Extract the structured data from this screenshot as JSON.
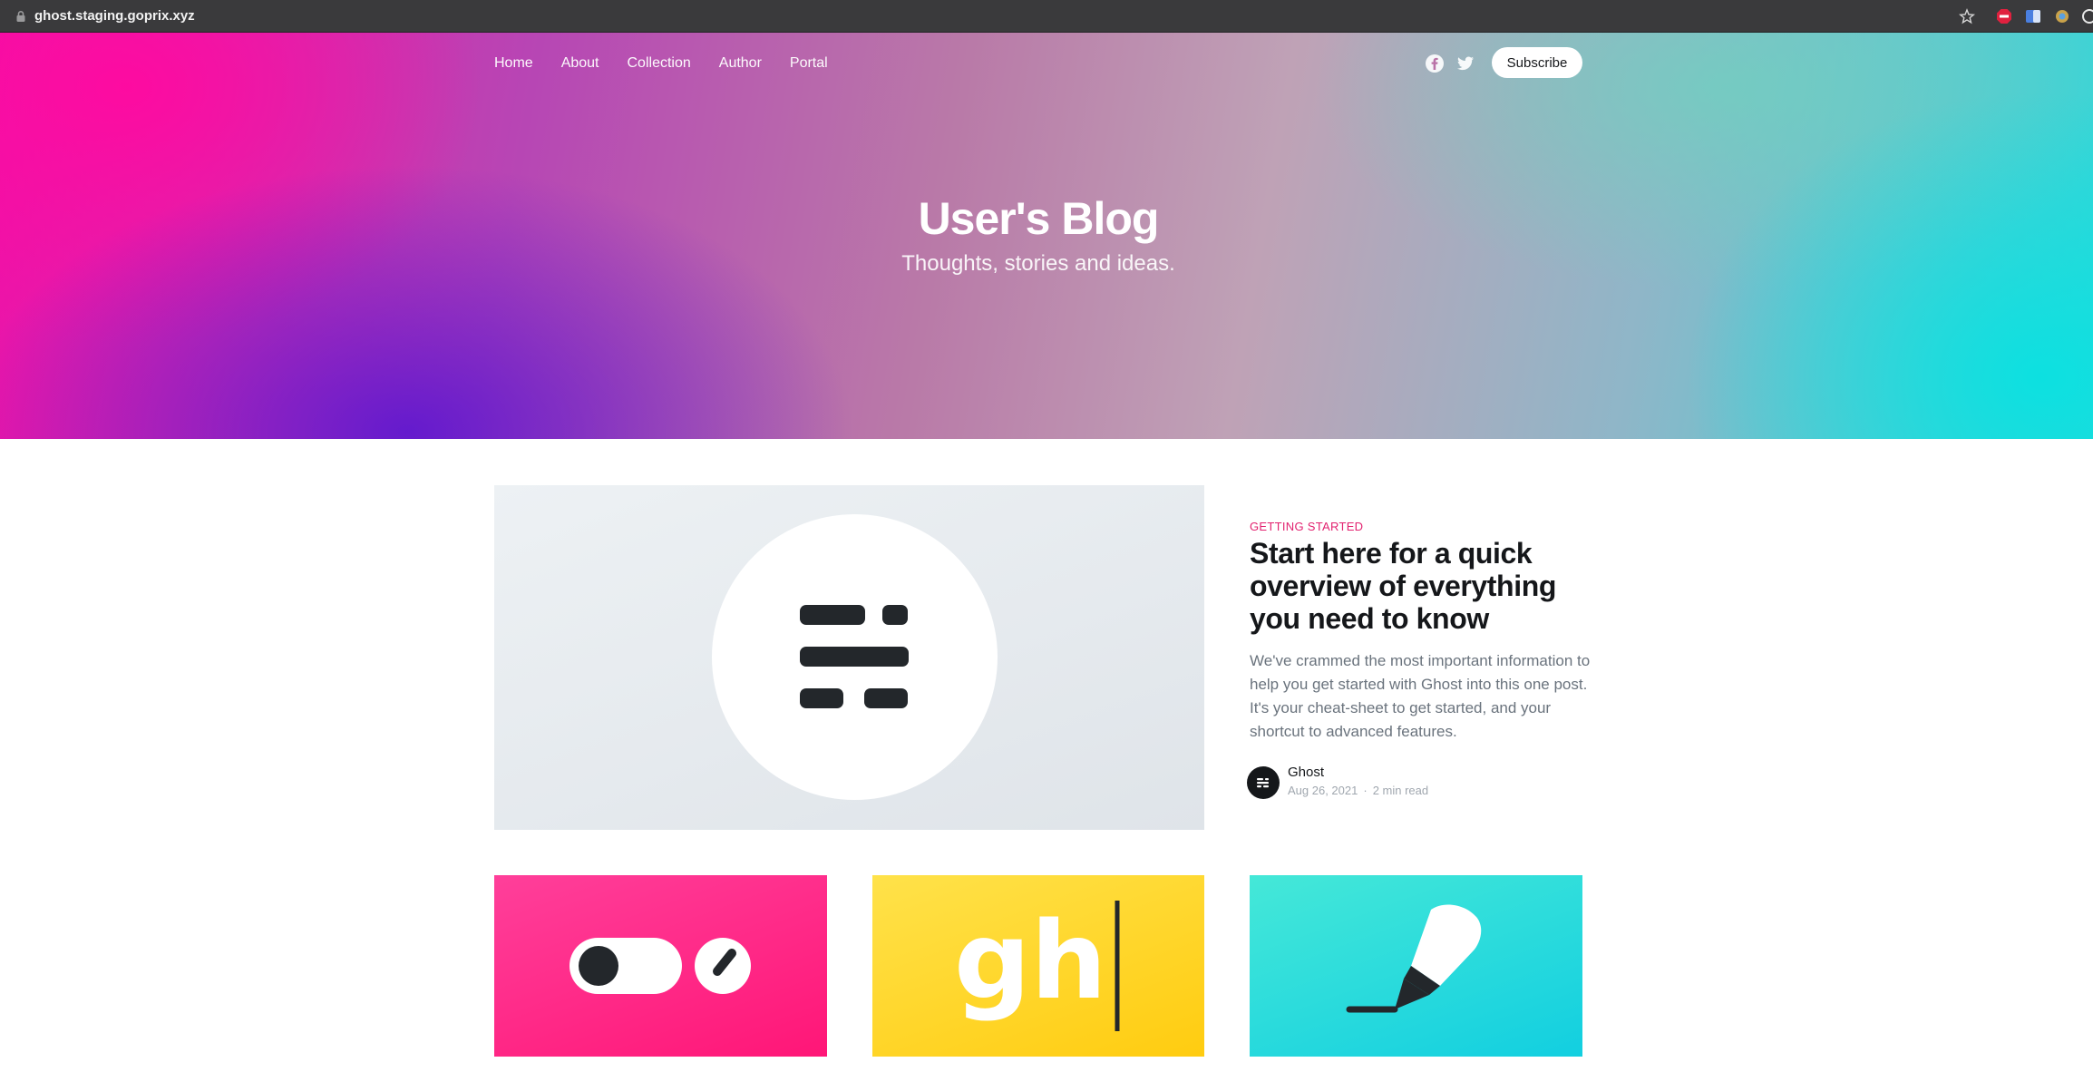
{
  "browser": {
    "url": "ghost.staging.goprix.xyz"
  },
  "nav": {
    "items": [
      {
        "label": "Home"
      },
      {
        "label": "About"
      },
      {
        "label": "Collection"
      },
      {
        "label": "Author"
      },
      {
        "label": "Portal"
      }
    ],
    "social_icons": [
      "facebook-icon",
      "twitter-icon"
    ],
    "subscribe_label": "Subscribe"
  },
  "hero": {
    "title": "User's Blog",
    "description": "Thoughts, stories and ideas."
  },
  "featured_post": {
    "tag": "GETTING STARTED",
    "title": "Start here for a quick overview of everything you need to know",
    "excerpt": "We've crammed the most important information to help you get started with Ghost into this one post. It's your cheat-sheet to get started, and your shortcut to advanced features.",
    "author": "Ghost",
    "date": "Aug 26, 2021",
    "separator": "·",
    "read_time": "2 min read"
  },
  "post_cards": [
    {
      "image": "toggle-settings-illustration"
    },
    {
      "image": "gh-typing-illustration",
      "text": "gh"
    },
    {
      "image": "pen-writing-illustration"
    }
  ],
  "colors": {
    "tag": "#e2216f",
    "card_pink": "#ff1677",
    "card_yellow": "#ffcc10",
    "card_teal": "#12cfe0"
  }
}
